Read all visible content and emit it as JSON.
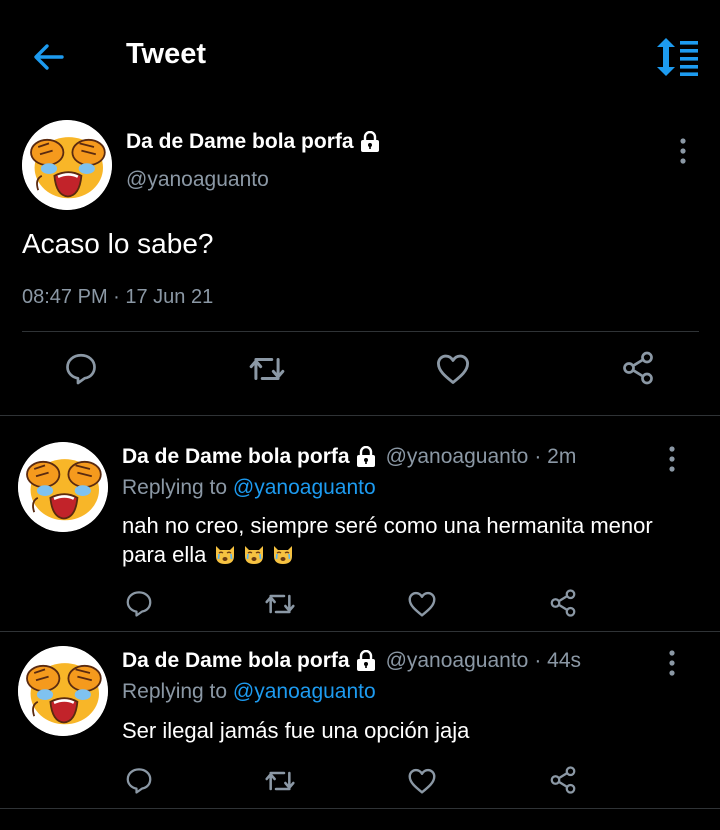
{
  "header": {
    "title": "Tweet",
    "back_icon": "back-arrow-icon",
    "sort_icon": "sort-order-icon"
  },
  "colors": {
    "accent": "#1d9bf0",
    "secondary_text": "#8b98a5",
    "divider": "#2f3336",
    "background": "#000000"
  },
  "main_tweet": {
    "display_name": "Da de Dame bola porfa",
    "handle": "@yanoaguanto",
    "text": "Acaso lo sabe?",
    "timestamp": "08:47 PM · 17 Jun 21"
  },
  "replies": [
    {
      "display_name": "Da de Dame bola porfa",
      "handle": "@yanoaguanto",
      "time": "· 2m",
      "replying_label": "Replying to",
      "replying_to": "@yanoaguanto",
      "text": "nah no creo, siempre seré como una hermanita menor para ella",
      "emoji": [
        "crying-cat-emoji",
        "crying-cat-emoji",
        "crying-cat-emoji"
      ]
    },
    {
      "display_name": "Da de Dame bola porfa",
      "handle": "@yanoaguanto",
      "time": "· 44s",
      "replying_label": "Replying to",
      "replying_to": "@yanoaguanto",
      "text": "Ser ilegal jamás fue una opción jaja",
      "emoji": []
    }
  ]
}
